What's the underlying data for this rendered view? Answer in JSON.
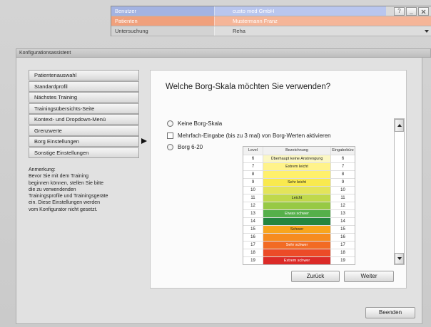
{
  "header": {
    "rows": [
      {
        "label": "Benutzer",
        "value": "custo med GmbH",
        "label_color": "#a3b3e2",
        "value_color": "#b9c6ee"
      },
      {
        "label": "Patienten",
        "value": "Mustermann Franz",
        "label_color": "#f0a07c",
        "value_color": "#f5b598"
      },
      {
        "label": "Untersuchung",
        "value": "Reha",
        "label_color": "#d3d3d3",
        "value_color": "#dddddd"
      }
    ],
    "window_buttons": {
      "help": "?",
      "minimize": "_"
    },
    "icons": {
      "close": "close-icon",
      "dropdown": "chevron-down-icon"
    }
  },
  "wizard": {
    "title": "Konfigurationsassistent",
    "nav_items": [
      {
        "label": "Patientenauswahl",
        "selected": false
      },
      {
        "label": "Standardprofil",
        "selected": false
      },
      {
        "label": "Nächstes Training",
        "selected": false
      },
      {
        "label": "Trainingsübersichts-Seite",
        "selected": false
      },
      {
        "label": "Kontext- und Dropdown-Menü",
        "selected": false
      },
      {
        "label": "Grenzwerte",
        "selected": false
      },
      {
        "label": "Borg Einstellungen",
        "selected": true
      },
      {
        "label": "Sonstige Einstellungen",
        "selected": false
      }
    ],
    "selected_indicator_icon": "arrow-right-icon",
    "note": [
      "Anmerkung:",
      "Bevor Sie mit dem Training",
      "beginnen können, stellen Sie bitte",
      "die zu verwendenden",
      "Trainingsprofile und Trainingsgeräte",
      "ein. Diese Einstellungen werden",
      "vom Konfigurator nicht gesetzt."
    ]
  },
  "page": {
    "question": "Welche Borg-Skala möchten Sie verwenden?",
    "options": [
      {
        "type": "radio",
        "label": "Keine Borg-Skala",
        "checked": false
      },
      {
        "type": "checkbox",
        "label": "Mehrfach-Eingabe (bis zu 3 mal) von Borg-Werten aktivieren",
        "checked": false
      },
      {
        "type": "radio",
        "label": "Borg 6-20",
        "checked": false
      }
    ],
    "scrollbar_icons": {
      "up": "up-arrow-icon",
      "down": "down-arrow-icon"
    },
    "borg_table": {
      "columns": [
        "Level",
        "Bezeichnung",
        "Eingabekürz"
      ],
      "rows": [
        {
          "level": 6,
          "label": "Überhaupt keine Anstrengung",
          "code": 6,
          "color": "#fbf7c4"
        },
        {
          "level": 7,
          "label": "Extrem leicht",
          "code": 7,
          "color": "#fff38a"
        },
        {
          "level": 8,
          "label": "",
          "code": 8,
          "color": "#fff06c"
        },
        {
          "level": 9,
          "label": "Sehr leicht",
          "code": 9,
          "color": "#f9e94e"
        },
        {
          "level": 10,
          "label": "",
          "code": 10,
          "color": "#e3e45a"
        },
        {
          "level": 11,
          "label": "Leicht",
          "code": 11,
          "color": "#bfd84b"
        },
        {
          "level": 12,
          "label": "",
          "code": 12,
          "color": "#97c945"
        },
        {
          "level": 13,
          "label": "Etwas schwer",
          "code": 13,
          "color": "#55b04a"
        },
        {
          "level": 14,
          "label": "",
          "code": 14,
          "color": "#23853f"
        },
        {
          "level": 15,
          "label": "Schwer",
          "code": 15,
          "color": "#f8a51d"
        },
        {
          "level": 16,
          "label": "",
          "code": 16,
          "color": "#f68c1f"
        },
        {
          "level": 17,
          "label": "Sehr schwer",
          "code": 17,
          "color": "#f26b24"
        },
        {
          "level": 18,
          "label": "",
          "code": 18,
          "color": "#ec4b27"
        },
        {
          "level": 19,
          "label": "Extrem schwer",
          "code": 19,
          "color": "#dc2a27"
        }
      ]
    },
    "buttons": {
      "back": "Zurück",
      "next": "Weiter"
    }
  },
  "footer": {
    "quit_button": "Beenden"
  }
}
